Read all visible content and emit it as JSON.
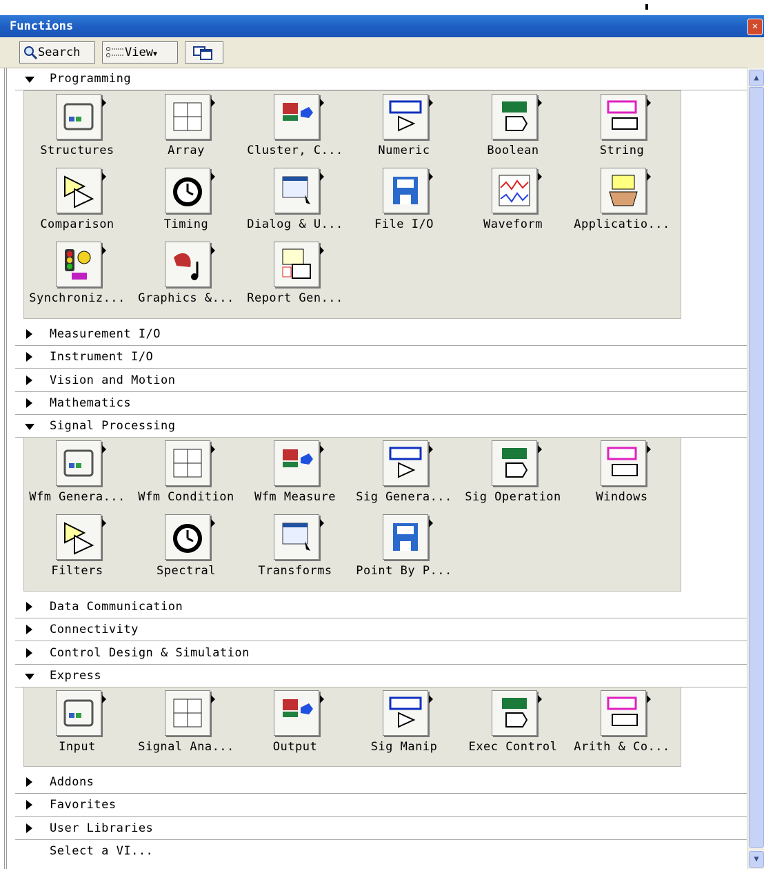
{
  "window": {
    "title": "Functions"
  },
  "toolbar": {
    "search_label": "Search",
    "view_label": "View"
  },
  "sections": {
    "programming": {
      "label": "Programming",
      "items": [
        "Structures",
        "Array",
        "Cluster, C...",
        "Numeric",
        "Boolean",
        "String",
        "Comparison",
        "Timing",
        "Dialog & U...",
        "File I/O",
        "Waveform",
        "Applicatio...",
        "Synchroniz...",
        "Graphics &...",
        "Report Gen..."
      ]
    },
    "measurement_io": {
      "label": "Measurement I/O"
    },
    "instrument_io": {
      "label": "Instrument I/O"
    },
    "vision_motion": {
      "label": "Vision and Motion"
    },
    "mathematics": {
      "label": "Mathematics"
    },
    "signal_processing": {
      "label": "Signal Processing",
      "items": [
        "Wfm Genera...",
        "Wfm Condition",
        "Wfm Measure",
        "Sig Genera...",
        "Sig Operation",
        "Windows",
        "Filters",
        "Spectral",
        "Transforms",
        "Point By P..."
      ]
    },
    "data_communication": {
      "label": "Data Communication"
    },
    "connectivity": {
      "label": "Connectivity"
    },
    "control_design": {
      "label": "Control Design & Simulation"
    },
    "express": {
      "label": "Express",
      "items": [
        "Input",
        "Signal Ana...",
        "Output",
        "Sig Manip",
        "Exec Control",
        "Arith & Co..."
      ]
    },
    "addons": {
      "label": "Addons"
    },
    "favorites": {
      "label": "Favorites"
    },
    "user_libraries": {
      "label": "User Libraries"
    },
    "select_vi": {
      "label": "Select a VI..."
    }
  },
  "icons": {
    "programming": [
      "structures-icon",
      "array-icon",
      "cluster-icon",
      "numeric-icon",
      "boolean-icon",
      "string-icon",
      "comparison-icon",
      "timing-icon",
      "dialog-icon",
      "file-io-icon",
      "waveform-icon",
      "application-control-icon",
      "synchronization-icon",
      "graphics-sound-icon",
      "report-generation-icon"
    ],
    "signal_processing": [
      "wfm-generation-icon",
      "wfm-conditioning-icon",
      "wfm-measurement-icon",
      "sig-generation-icon",
      "sig-operation-icon",
      "windows-icon",
      "filters-icon",
      "spectral-icon",
      "transforms-icon",
      "point-by-point-icon"
    ],
    "express": [
      "input-icon",
      "signal-analysis-icon",
      "output-icon",
      "sig-manip-icon",
      "exec-control-icon",
      "arith-compare-icon"
    ]
  }
}
